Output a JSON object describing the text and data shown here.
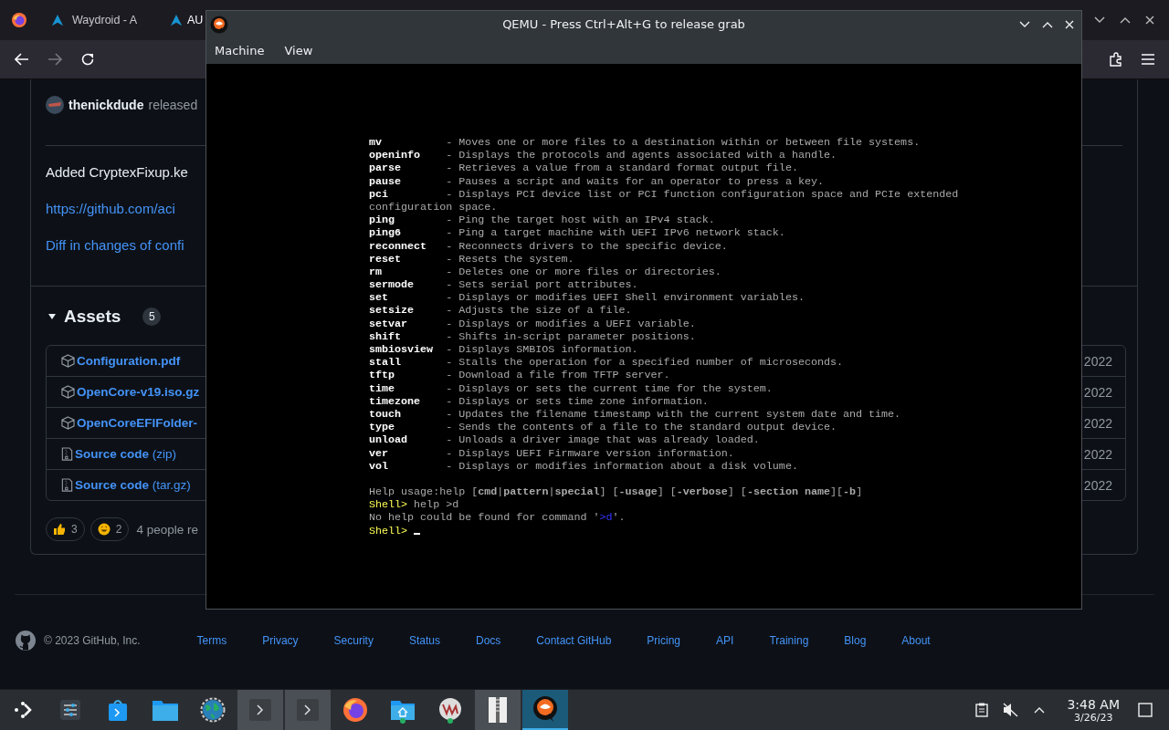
{
  "browser": {
    "tabs": [
      {
        "kind": "firefox"
      },
      {
        "kind": "page",
        "title": "Waydroid - A"
      },
      {
        "kind": "page",
        "title": "AU"
      }
    ]
  },
  "release": {
    "author": "thenickdude",
    "action": "released",
    "body": [
      {
        "kind": "text",
        "text": "Added CryptexFixup.ke"
      },
      {
        "kind": "link",
        "text": "https://github.com/aci"
      },
      {
        "kind": "link",
        "text": "Diff in changes of confi"
      }
    ],
    "assets": {
      "title": "Assets",
      "count": "5",
      "items": [
        {
          "kind": "package",
          "name": "Configuration.pdf",
          "date": "2022"
        },
        {
          "kind": "package",
          "name": "OpenCore-v19.iso.gz",
          "date": "2022"
        },
        {
          "kind": "package",
          "name": "OpenCoreEFIFolder-",
          "date": "2022"
        },
        {
          "kind": "source",
          "name": "Source code",
          "format": "(zip)",
          "date": "2022"
        },
        {
          "kind": "source",
          "name": "Source code",
          "format": "(tar.gz)",
          "date": "2022"
        }
      ]
    },
    "reactions": [
      {
        "kind": "thumbs_up",
        "count": "3"
      },
      {
        "kind": "smile",
        "count": "2"
      }
    ],
    "reaction_summary": "4 people re"
  },
  "qemu": {
    "title": "QEMU - Press Ctrl+Alt+G to release grab",
    "menu": [
      "Machine",
      "View"
    ],
    "console": [
      {
        "kind": "command",
        "name": "mv",
        "description": "- Moves one or more files to a destination within or between file systems."
      },
      {
        "kind": "command",
        "name": "openinfo",
        "description": "- Displays the protocols and agents associated with a handle."
      },
      {
        "kind": "command",
        "name": "parse",
        "description": "- Retrieves a value from a standard format output file."
      },
      {
        "kind": "command",
        "name": "pause",
        "description": "- Pauses a script and waits for an operator to press a key."
      },
      {
        "kind": "command",
        "name": "pci",
        "description": "- Displays PCI device list or PCI function configuration space and PCIe extended"
      },
      {
        "kind": "wrap",
        "text": "configuration space."
      },
      {
        "kind": "command",
        "name": "ping",
        "description": "- Ping the target host with an IPv4 stack."
      },
      {
        "kind": "command",
        "name": "ping6",
        "description": "- Ping a target machine with UEFI IPv6 network stack."
      },
      {
        "kind": "command",
        "name": "reconnect",
        "description": "- Reconnects drivers to the specific device."
      },
      {
        "kind": "command",
        "name": "reset",
        "description": "- Resets the system."
      },
      {
        "kind": "command",
        "name": "rm",
        "description": "- Deletes one or more files or directories."
      },
      {
        "kind": "command",
        "name": "sermode",
        "description": "- Sets serial port attributes."
      },
      {
        "kind": "command",
        "name": "set",
        "description": "- Displays or modifies UEFI Shell environment variables."
      },
      {
        "kind": "command",
        "name": "setsize",
        "description": "- Adjusts the size of a file."
      },
      {
        "kind": "command",
        "name": "setvar",
        "description": "- Displays or modifies a UEFI variable."
      },
      {
        "kind": "command",
        "name": "shift",
        "description": "- Shifts in-script parameter positions."
      },
      {
        "kind": "command",
        "name": "smbiosview",
        "description": "- Displays SMBIOS information."
      },
      {
        "kind": "command",
        "name": "stall",
        "description": "- Stalls the operation for a specified number of microseconds."
      },
      {
        "kind": "command",
        "name": "tftp",
        "description": "- Download a file from TFTP server."
      },
      {
        "kind": "command",
        "name": "time",
        "description": "- Displays or sets the current time for the system."
      },
      {
        "kind": "command",
        "name": "timezone",
        "description": "- Displays or sets time zone information."
      },
      {
        "kind": "command",
        "name": "touch",
        "description": "- Updates the filename timestamp with the current system date and time."
      },
      {
        "kind": "command",
        "name": "type",
        "description": "- Sends the contents of a file to the standard output device."
      },
      {
        "kind": "command",
        "name": "unload",
        "description": "- Unloads a driver image that was already loaded."
      },
      {
        "kind": "command",
        "name": "ver",
        "description": "- Displays UEFI Firmware version information."
      },
      {
        "kind": "command",
        "name": "vol",
        "description": "- Displays or modifies information about a disk volume."
      },
      {
        "kind": "blank"
      },
      {
        "kind": "usage",
        "text": "Help usage:help [**cmd**|**pattern**|**special**] [**-usage**] [**-verbose**] [**-section name**][**-b**]"
      },
      {
        "kind": "prompt",
        "prompt": "Shell>",
        "input": "help >d"
      },
      {
        "kind": "error",
        "before": "No help could be found for command '",
        "highlight": ">d",
        "after": "'."
      },
      {
        "kind": "prompt",
        "prompt": "Shell>",
        "cursor": true
      }
    ]
  },
  "footer": {
    "copyright": "© 2023 GitHub, Inc.",
    "links": [
      "Terms",
      "Privacy",
      "Security",
      "Status",
      "Docs",
      "Contact GitHub",
      "Pricing",
      "API",
      "Training",
      "Blog",
      "About"
    ]
  },
  "taskbar": {
    "apps": [
      {
        "kind": "launcher",
        "running": false,
        "selected": false
      },
      {
        "kind": "settings",
        "running": false,
        "selected": false
      },
      {
        "kind": "store",
        "running": false,
        "selected": false
      },
      {
        "kind": "folder",
        "running": false,
        "selected": false
      },
      {
        "kind": "globe",
        "running": false,
        "selected": false
      },
      {
        "kind": "terminal",
        "running": true,
        "selected": false
      },
      {
        "kind": "terminal",
        "running": true,
        "selected": false
      },
      {
        "kind": "firefox",
        "running": false,
        "selected": false
      },
      {
        "kind": "home",
        "running": false,
        "selected": false
      },
      {
        "kind": "virt",
        "running": false,
        "selected": false
      },
      {
        "kind": "archive",
        "running": true,
        "selected": false
      },
      {
        "kind": "qemu",
        "running": true,
        "selected": true
      }
    ],
    "clock": {
      "time": "3:48 AM",
      "date": "3/26/23"
    }
  }
}
